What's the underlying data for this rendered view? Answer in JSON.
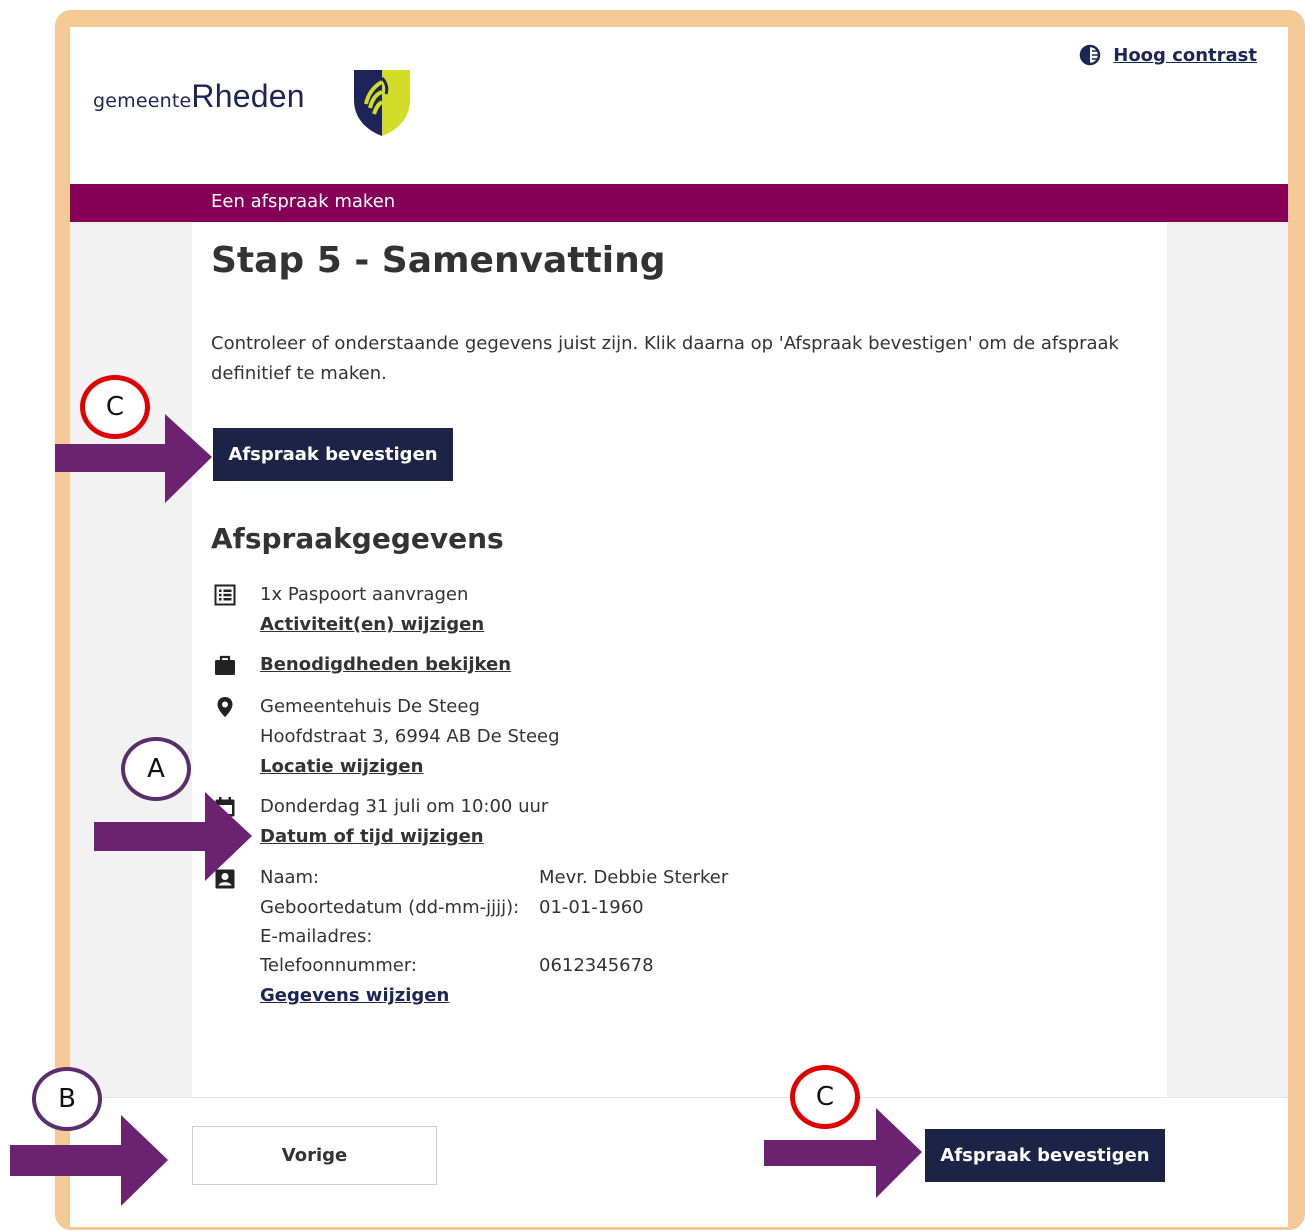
{
  "header": {
    "logo_small": "gemeente",
    "logo_big": "Rheden",
    "contrast_label": "Hoog contrast"
  },
  "banner": {
    "title": "Een afspraak maken"
  },
  "main": {
    "heading": "Stap 5 - Samenvatting",
    "intro": "Controleer of onderstaande gegevens juist zijn. Klik daarna op 'Afspraak bevestigen' om de afspraak definitief te maken.",
    "confirm_label": "Afspraak bevestigen",
    "section_title": "Afspraakgegevens"
  },
  "details": {
    "activity": "1x Paspoort aanvragen",
    "activity_link": "Activiteit(en) wijzigen",
    "requirements_link": "Benodigdheden bekijken",
    "location_name": "Gemeentehuis De Steeg",
    "location_address": "Hoofdstraat 3, 6994 AB De Steeg",
    "location_link": "Locatie wijzigen",
    "datetime": "Donderdag 31 juli om 10:00 uur",
    "datetime_link": "Datum of tijd wijzigen",
    "person": [
      {
        "label": "Naam:",
        "value": "Mevr. Debbie Sterker"
      },
      {
        "label": "Geboortedatum (dd-mm-jjjj):",
        "value": "01-01-1960"
      },
      {
        "label": "E-mailadres:",
        "value": ""
      },
      {
        "label": "Telefoonnummer:",
        "value": "0612345678"
      }
    ],
    "person_link": "Gegevens wijzigen"
  },
  "footer": {
    "prev_label": "Vorige",
    "confirm_label": "Afspraak bevestigen"
  },
  "annotations": {
    "marker_a": "A",
    "marker_b": "B",
    "marker_c": "C",
    "red": "#e00000",
    "purple": "#5a2d6e",
    "arrow": "#6b2270"
  },
  "colors": {
    "banner": "#860057",
    "button": "#1d2347",
    "link": "#1d2457",
    "frame": "#f5c995"
  }
}
